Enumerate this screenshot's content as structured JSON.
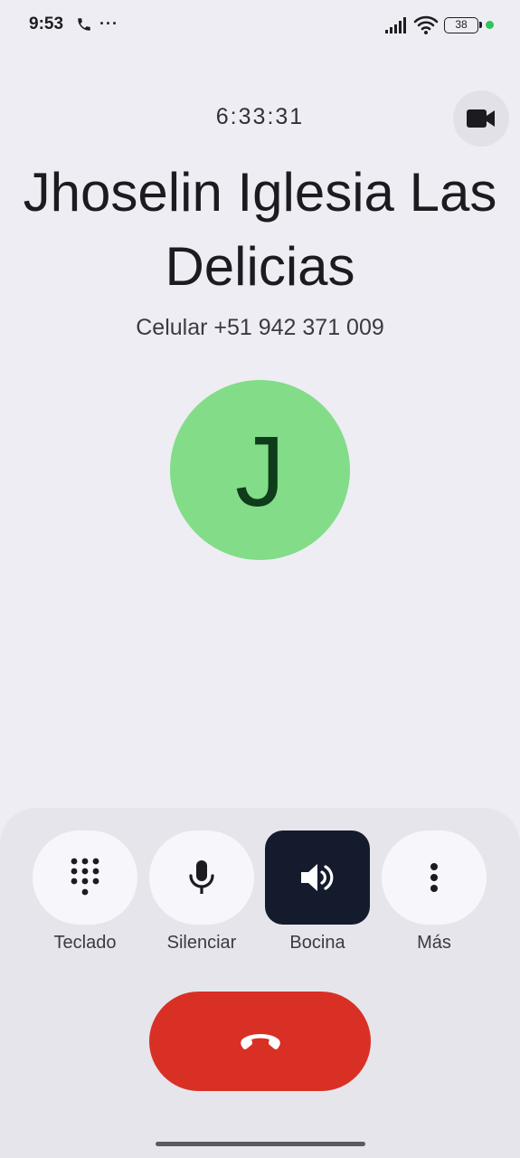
{
  "status_bar": {
    "time": "9:53",
    "call_icon": "phone-icon",
    "more": "···",
    "signal_icon": "signal-icon",
    "wifi_icon": "wifi-icon",
    "battery": "38",
    "indicator_color": "#2fc45d"
  },
  "call": {
    "timer": "6:33:31",
    "video_icon": "videocam-icon",
    "name": "Jhoselin Iglesia Las Delicias",
    "number": "Celular +51 942 371 009",
    "avatar_letter": "J",
    "avatar_color": "#83dc88"
  },
  "actions": [
    {
      "label": "Teclado",
      "icon": "dialpad-icon",
      "active": false
    },
    {
      "label": "Silenciar",
      "icon": "mic-icon",
      "active": false
    },
    {
      "label": "Bocina",
      "icon": "speaker-icon",
      "active": true
    },
    {
      "label": "Más",
      "icon": "more-vert-icon",
      "active": false
    }
  ],
  "hangup": {
    "icon": "call-end-icon",
    "color": "#d93025"
  }
}
